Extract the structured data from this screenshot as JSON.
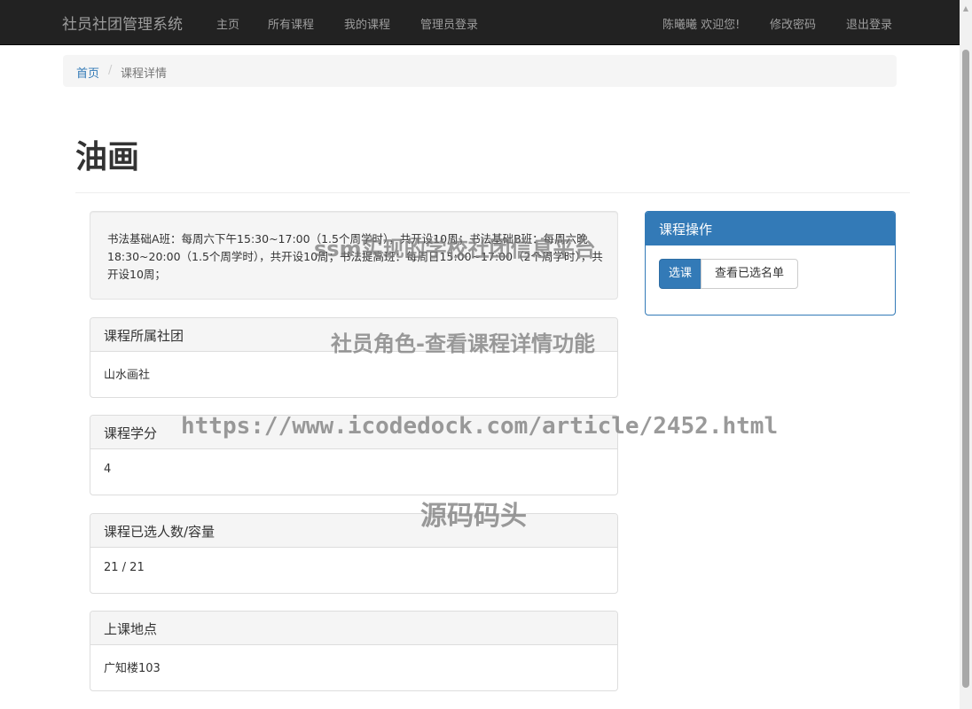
{
  "navbar": {
    "brand": "社员社团管理系统",
    "items": [
      "主页",
      "所有课程",
      "我的课程",
      "管理员登录"
    ],
    "user_greeting": "陈曦曦 欢迎您!",
    "change_password": "修改密码",
    "logout": "退出登录"
  },
  "breadcrumb": {
    "home": "首页",
    "separator": "/",
    "current": "课程详情"
  },
  "page": {
    "title": "油画"
  },
  "description": "书法基础A班：每周六下午15:30~17:00（1.5个周学时），共开设10周；书法基础B班：每周六晚18:30~20:00（1.5个周学时），共开设10周；书法提高班：每周日15:00~17:00（2个周学时），共开设10周；",
  "panels": [
    {
      "heading": "课程所属社团",
      "value": "山水画社"
    },
    {
      "heading": "课程学分",
      "value": "4"
    },
    {
      "heading": "课程已选人数/容量",
      "value": "21 / 21"
    },
    {
      "heading": "上课地点",
      "value": "广知楼103"
    }
  ],
  "operations": {
    "heading": "课程操作",
    "enroll_button": "选课",
    "view_list_button": "查看已选名单"
  },
  "watermarks": {
    "line1": "ssm实现的学校社团信息平台",
    "line2": "社员角色-查看课程详情功能",
    "line3": "https://www.icodedock.com/article/2452.html",
    "line4": "源码码头"
  }
}
